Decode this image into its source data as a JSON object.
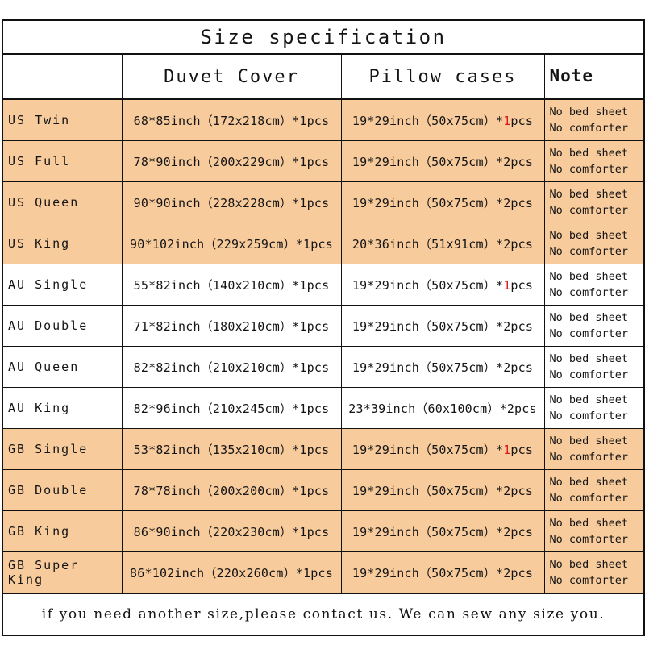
{
  "table": {
    "title": "Size specification",
    "columns": {
      "size_label": "",
      "duvet": "Duvet Cover",
      "pillow": "Pillow cases",
      "note": "Note"
    },
    "note_lines": {
      "line1": "No bed sheet",
      "line2": "No comforter"
    },
    "rows": [
      {
        "size": "US Twin",
        "duvet": "68*85inch（172x218cm）*1pcs",
        "pillow_pre": "19*29inch（50x75cm）*",
        "pillow_qty": "1",
        "pillow_post": "pcs",
        "pillow_qty_red": true,
        "shaded": true
      },
      {
        "size": "US Full",
        "duvet": "78*90inch（200x229cm）*1pcs",
        "pillow_pre": "19*29inch（50x75cm）*",
        "pillow_qty": "2",
        "pillow_post": "pcs",
        "pillow_qty_red": false,
        "shaded": true
      },
      {
        "size": "US Queen",
        "duvet": "90*90inch（228x228cm）*1pcs",
        "pillow_pre": "19*29inch（50x75cm）*",
        "pillow_qty": "2",
        "pillow_post": "pcs",
        "pillow_qty_red": false,
        "shaded": true
      },
      {
        "size": "US King",
        "duvet": "90*102inch（229x259cm）*1pcs",
        "pillow_pre": "20*36inch（51x91cm）*",
        "pillow_qty": "2",
        "pillow_post": "pcs",
        "pillow_qty_red": false,
        "shaded": true
      },
      {
        "size": "AU Single",
        "duvet": "55*82inch（140x210cm）*1pcs",
        "pillow_pre": "19*29inch（50x75cm）*",
        "pillow_qty": "1",
        "pillow_post": "pcs",
        "pillow_qty_red": true,
        "shaded": false
      },
      {
        "size": "AU Double",
        "duvet": "71*82inch（180x210cm）*1pcs",
        "pillow_pre": "19*29inch（50x75cm）*",
        "pillow_qty": "2",
        "pillow_post": "pcs",
        "pillow_qty_red": false,
        "shaded": false
      },
      {
        "size": "AU Queen",
        "duvet": "82*82inch（210x210cm）*1pcs",
        "pillow_pre": "19*29inch（50x75cm）*",
        "pillow_qty": "2",
        "pillow_post": "pcs",
        "pillow_qty_red": false,
        "shaded": false
      },
      {
        "size": "AU King",
        "duvet": "82*96inch（210x245cm）*1pcs",
        "pillow_pre": "23*39inch（60x100cm）*",
        "pillow_qty": "2",
        "pillow_post": "pcs",
        "pillow_qty_red": false,
        "shaded": false
      },
      {
        "size": "GB Single",
        "duvet": "53*82inch（135x210cm）*1pcs",
        "pillow_pre": "19*29inch（50x75cm）*",
        "pillow_qty": "1",
        "pillow_post": "pcs",
        "pillow_qty_red": true,
        "shaded": true
      },
      {
        "size": "GB Double",
        "duvet": "78*78inch（200x200cm）*1pcs",
        "pillow_pre": "19*29inch（50x75cm）*",
        "pillow_qty": "2",
        "pillow_post": "pcs",
        "pillow_qty_red": false,
        "shaded": true
      },
      {
        "size": "GB King",
        "duvet": "86*90inch（220x230cm）*1pcs",
        "pillow_pre": "19*29inch（50x75cm）*",
        "pillow_qty": "2",
        "pillow_post": "pcs",
        "pillow_qty_red": false,
        "shaded": true
      },
      {
        "size": "GB Super King",
        "duvet": "86*102inch（220x260cm）*1pcs",
        "pillow_pre": "19*29inch（50x75cm）*",
        "pillow_qty": "2",
        "pillow_post": "pcs",
        "pillow_qty_red": false,
        "shaded": true
      }
    ],
    "footer": "if you need another size,please contact us. We can sew any size you."
  },
  "colors": {
    "shaded_row": "#F7CB9C",
    "border": "#111111",
    "text": "#141414",
    "accent_red": "#E01818",
    "footer_red": "#E52222"
  }
}
